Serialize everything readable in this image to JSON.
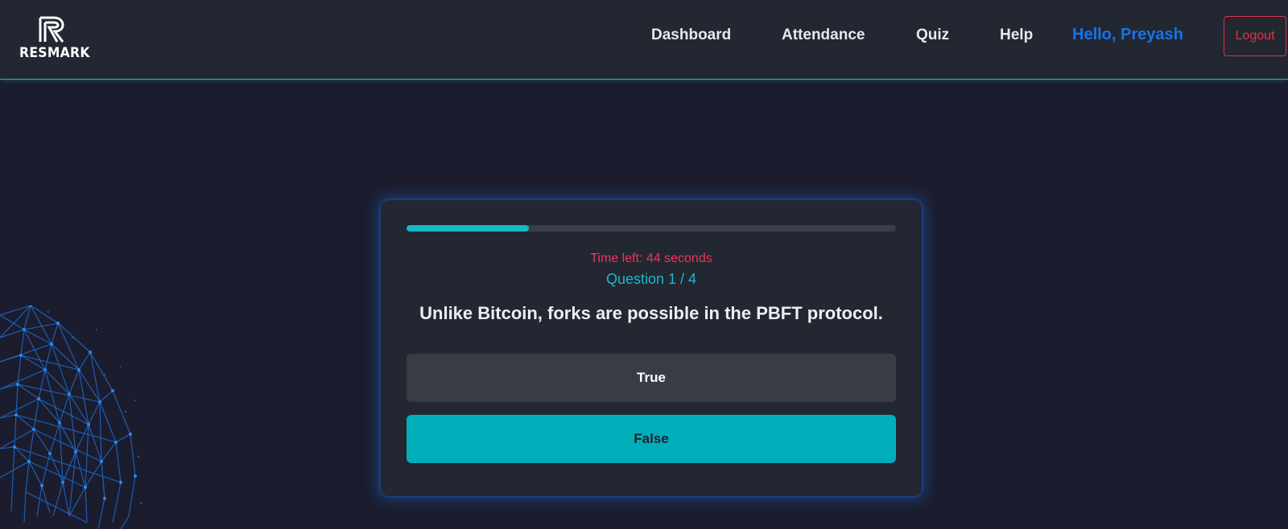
{
  "brand": {
    "name": "RESMARK"
  },
  "nav": {
    "links": [
      "Dashboard",
      "Attendance",
      "Quiz",
      "Help"
    ],
    "greeting": "Hello, Preyash",
    "logout_label": "Logout"
  },
  "quiz": {
    "progress_fraction": 0.25,
    "timer_text": "Time left: 44 seconds",
    "question_counter": "Question 1 / 4",
    "question": "Unlike Bitcoin, forks are possible in the PBFT protocol.",
    "options": [
      "True",
      "False"
    ],
    "selected_option": "False"
  },
  "colors": {
    "accent": "#1fb6c9",
    "greeting": "#1a73e8",
    "timer": "#f0355b",
    "logout": "#dc3545",
    "selected_option": "#00aeb9"
  }
}
